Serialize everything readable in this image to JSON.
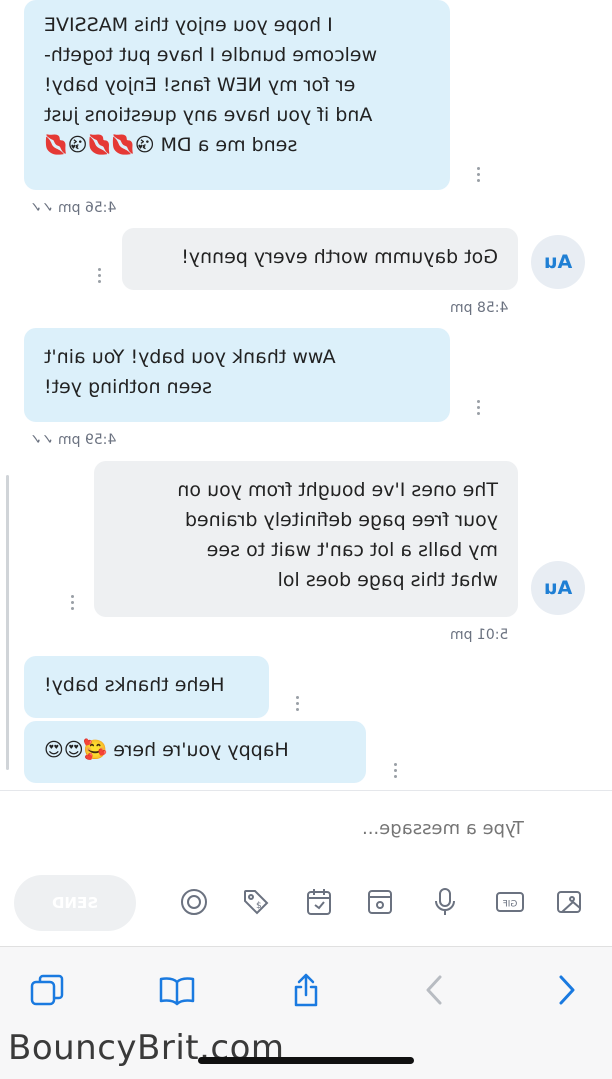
{
  "messages": [
    {
      "id": "m1",
      "dir": "out",
      "lines": [
        "I hope you enjoy this MASSIVE",
        "welcome bundle I have put togeth-",
        "er for my NEW fans! Enjoy baby!",
        "And if you have any questions just",
        "send me a DM 😘💋💋😘💋"
      ],
      "time": "4:56 pm"
    },
    {
      "id": "m2",
      "dir": "in",
      "lines": [
        "Got dayumm worth every penny!"
      ],
      "time": "4:58 pm",
      "avatar": "Au"
    },
    {
      "id": "m3",
      "dir": "out",
      "lines": [
        "Aww thank you baby! You ain't",
        "seen nothing yet!"
      ],
      "time": "4:59 pm"
    },
    {
      "id": "m4",
      "dir": "in",
      "lines": [
        "The ones I've bought from you on",
        "your free page definitely drained",
        "my balls a lot can't wait to see",
        "what this page does lol"
      ],
      "time": "5:01 pm",
      "avatar": "Au"
    },
    {
      "id": "m5",
      "dir": "out",
      "lines": [
        "Hehe thanks baby!"
      ]
    },
    {
      "id": "m6",
      "dir": "out",
      "lines": [
        "Happy you're here 🥰😍😍"
      ]
    }
  ],
  "composer": {
    "placeholder": "Type a message...",
    "send_label": "SEND"
  },
  "tools": [
    "image-icon",
    "gif-icon",
    "microphone-icon",
    "media-vault-icon",
    "schedule-icon",
    "price-tag-icon",
    "quiz-icon"
  ],
  "watermark": "BouncyBrit.com",
  "colors": {
    "accent": "#1a7ae0",
    "out_bubble": "#dcf0fa",
    "in_bubble": "#eef0f2"
  }
}
